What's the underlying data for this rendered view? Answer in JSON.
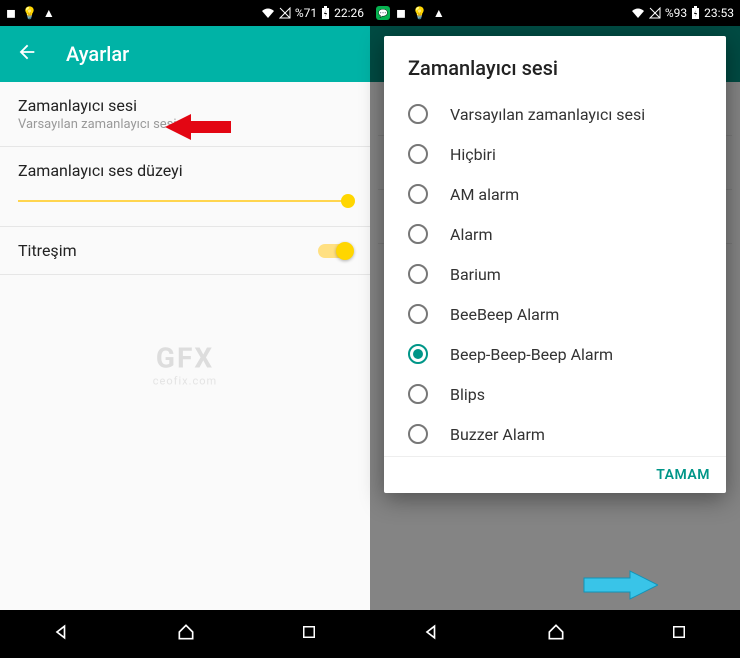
{
  "left": {
    "status": {
      "battery": "%71",
      "time": "22:26"
    },
    "appbar": {
      "title": "Ayarlar"
    },
    "items": {
      "sound": {
        "title": "Zamanlayıcı sesi",
        "subtitle": "Varsayılan zamanlayıcı sesi"
      },
      "volume": {
        "title": "Zamanlayıcı ses düzeyi"
      },
      "vibrate": {
        "title": "Titreşim"
      }
    },
    "watermark": {
      "big": "GFX",
      "small": "ceofix.com"
    }
  },
  "right": {
    "status": {
      "battery": "%93",
      "time": "23:53"
    },
    "dialog": {
      "title": "Zamanlayıcı sesi",
      "ok": "TAMAM",
      "selected": 6,
      "options": [
        "Varsayılan zamanlayıcı sesi",
        "Hiçbiri",
        "AM alarm",
        "Alarm",
        "Barium",
        "BeeBeep Alarm",
        "Beep-Beep-Beep Alarm",
        "Blips",
        "Buzzer Alarm"
      ]
    }
  }
}
